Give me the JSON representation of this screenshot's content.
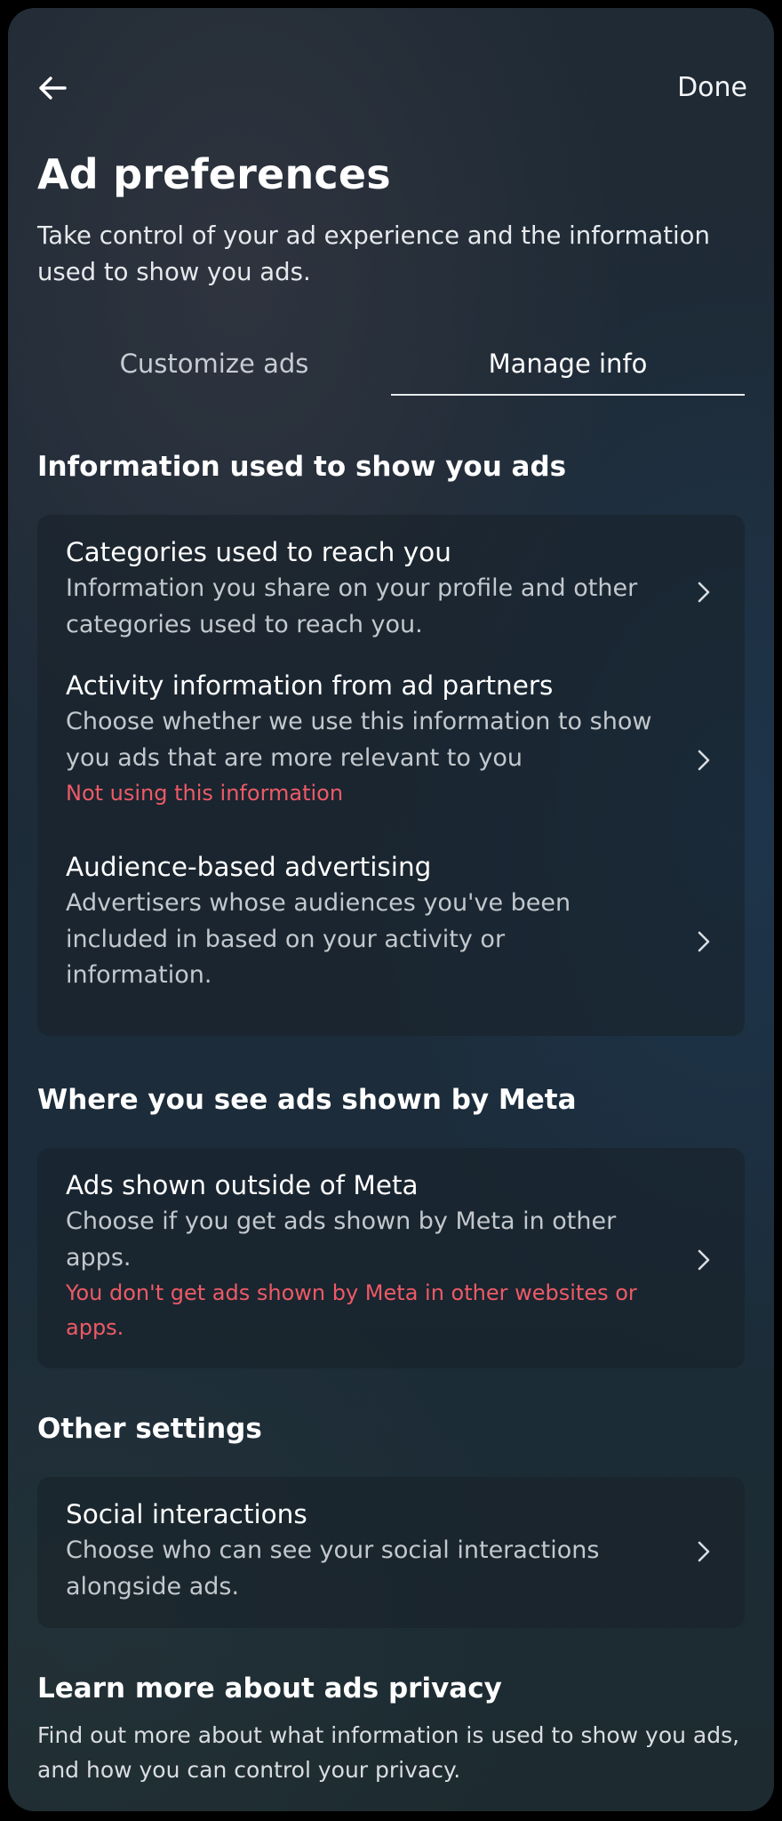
{
  "header": {
    "back_icon": "arrow-left-icon",
    "done_label": "Done",
    "title": "Ad preferences",
    "description": "Take control of your ad experience and the information used to show you ads."
  },
  "tabs": [
    {
      "label": "Customize ads",
      "active": false
    },
    {
      "label": "Manage info",
      "active": true
    }
  ],
  "sections": {
    "info_used": {
      "heading": "Information used to show you ads",
      "items": [
        {
          "title": "Categories used to reach you",
          "description": "Information you share on your profile and other categories used to reach you."
        },
        {
          "title": "Activity information from ad partners",
          "description": "Choose whether we use this information to show you ads that are more relevant to you",
          "status": "Not using this information"
        },
        {
          "title": "Audience-based advertising",
          "description": "Advertisers whose audiences you've been included in based on your activity or information."
        }
      ]
    },
    "where_seen": {
      "heading": "Where you see ads shown by Meta",
      "items": [
        {
          "title": "Ads shown outside of Meta",
          "description": "Choose if you get ads shown by Meta in other apps.",
          "status": "You don't get ads shown by Meta in other websites or apps."
        }
      ]
    },
    "other": {
      "heading": "Other settings",
      "items": [
        {
          "title": "Social interactions",
          "description": "Choose who can see your social interactions alongside ads."
        }
      ]
    }
  },
  "learn_more": {
    "title": "Learn more about ads privacy",
    "description": "Find out more about what information is used to show you ads, and how you can control your privacy."
  },
  "colors": {
    "warning": "#ee5a66",
    "text_primary": "#ffffff",
    "text_secondary": "#c2c8cd"
  },
  "icons": {
    "chevron": "chevron-right-icon"
  }
}
